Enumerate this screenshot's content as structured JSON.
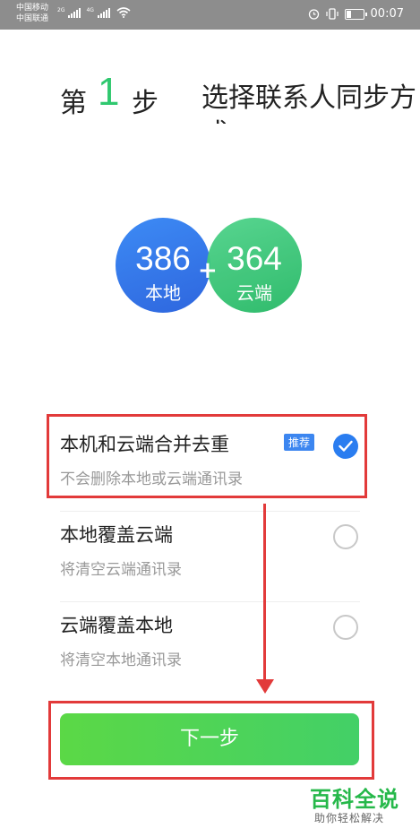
{
  "status_bar": {
    "carrier1": "中国移动",
    "carrier2": "中国联通",
    "sig1_tag": "2G",
    "sig2_tag": "4G",
    "time": "00:07"
  },
  "header": {
    "step_prefix": "第",
    "step_number": "1",
    "step_suffix": "步",
    "description": "选择联系人同步方式"
  },
  "counts": {
    "local_count": "386",
    "local_label": "本地",
    "cloud_count": "364",
    "cloud_label": "云端",
    "plus": "+"
  },
  "options": [
    {
      "title": "本机和云端合并去重",
      "subtitle": "不会删除本地或云端通讯录",
      "badge": "推荐",
      "selected": true
    },
    {
      "title": "本地覆盖云端",
      "subtitle": "将清空云端通讯录",
      "selected": false
    },
    {
      "title": "云端覆盖本地",
      "subtitle": "将清空本地通讯录",
      "selected": false
    }
  ],
  "next_button": "下一步",
  "watermark": {
    "title": "百科全说",
    "subtitle": "助你轻松解决"
  },
  "colors": {
    "accent_green": "#2fc86f",
    "accent_blue": "#2a7df0",
    "highlight_red": "#e23a3a"
  }
}
